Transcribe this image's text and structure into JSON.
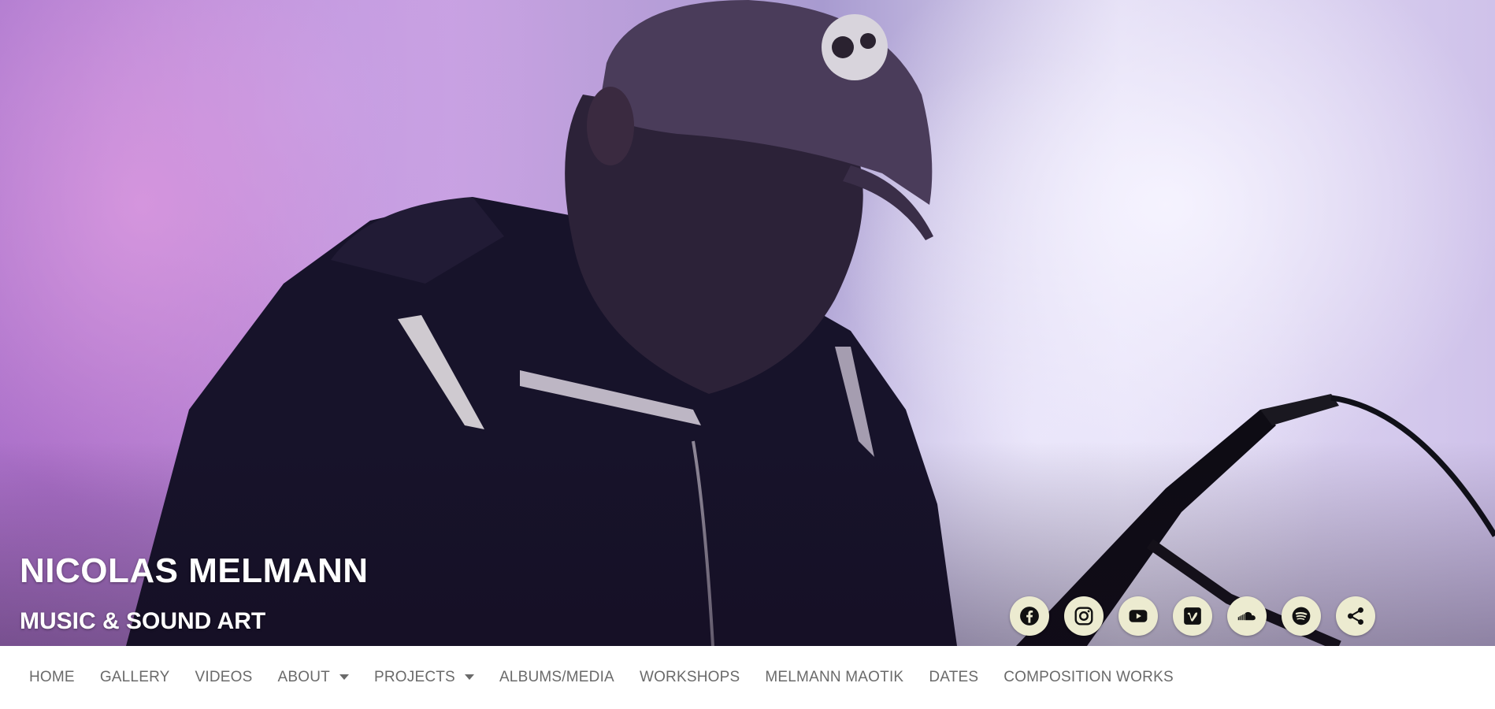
{
  "hero": {
    "title": "NICOLAS MELMANN",
    "tagline": "MUSIC & SOUND ART",
    "image_alt": "performer in cap and hoodie in front of a purple visual projection"
  },
  "social": [
    {
      "name": "facebook",
      "icon": "facebook-icon"
    },
    {
      "name": "instagram",
      "icon": "instagram-icon"
    },
    {
      "name": "youtube",
      "icon": "youtube-icon"
    },
    {
      "name": "vimeo",
      "icon": "vimeo-icon"
    },
    {
      "name": "soundcloud",
      "icon": "soundcloud-icon"
    },
    {
      "name": "spotify",
      "icon": "spotify-icon"
    },
    {
      "name": "share",
      "icon": "share-icon"
    }
  ],
  "nav": {
    "items": [
      {
        "label": "HOME"
      },
      {
        "label": "GALLERY"
      },
      {
        "label": "VIDEOS"
      },
      {
        "label": "ABOUT",
        "dropdown": true
      },
      {
        "label": "PROJECTS",
        "dropdown": true
      },
      {
        "label": "ALBUMS/MEDIA"
      },
      {
        "label": "WORKSHOPS"
      },
      {
        "label": "MELMANN MAOTIK"
      },
      {
        "label": "DATES"
      },
      {
        "label": "COMPOSITION WORKS"
      }
    ]
  },
  "colors": {
    "social_button_bg": "#ecebd0",
    "nav_text": "#6a6a6a",
    "hero_text": "#ffffff"
  }
}
